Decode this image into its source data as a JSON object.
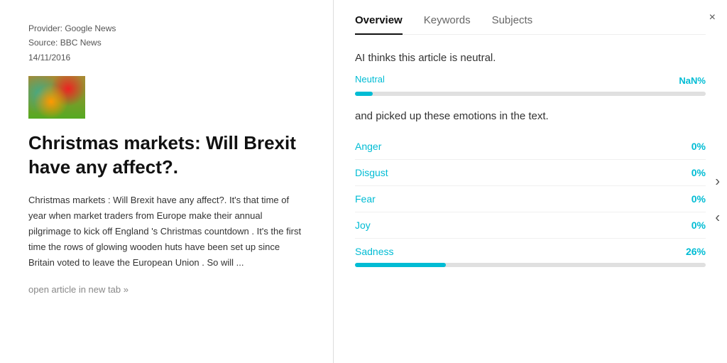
{
  "left": {
    "provider": "Provider: Google News",
    "source": "Source: BBC News",
    "date": "14/11/2016",
    "title": "Christmas markets: Will Brexit have any affect?.",
    "body": "Christmas markets : Will Brexit have any affect?. It's that time  of year when  market traders  from Europe make their annual pilgrimage  to kick off  England 's Christmas countdown . It's the first  time  the  rows  of  glowing wooden huts  have been set up since Britain voted to leave the  European Union . So will ...",
    "open_link": "open article in new tab »"
  },
  "right": {
    "tabs": [
      {
        "label": "Overview",
        "active": true
      },
      {
        "label": "Keywords",
        "active": false
      },
      {
        "label": "Subjects",
        "active": false
      }
    ],
    "sentiment_heading": "AI thinks this article is neutral.",
    "neutral_label": "Neutral",
    "neutral_value": "NaN%",
    "neutral_bar_pct": 5,
    "emotions_heading": "and picked up these emotions in the text.",
    "emotions": [
      {
        "label": "Anger",
        "value": "0%",
        "bar_pct": 0,
        "has_bar": false
      },
      {
        "label": "Disgust",
        "value": "0%",
        "bar_pct": 0,
        "has_bar": false
      },
      {
        "label": "Fear",
        "value": "0%",
        "bar_pct": 0,
        "has_bar": false
      },
      {
        "label": "Joy",
        "value": "0%",
        "bar_pct": 0,
        "has_bar": false
      },
      {
        "label": "Sadness",
        "value": "26%",
        "bar_pct": 26,
        "has_bar": true
      }
    ]
  },
  "nav": {
    "close": "×",
    "next": "›",
    "prev": "‹"
  }
}
